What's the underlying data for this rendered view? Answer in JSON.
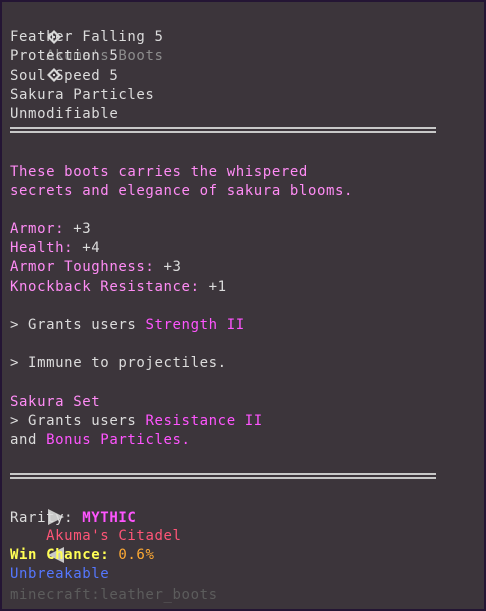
{
  "item": {
    "name": "Akuma's Boots",
    "icon_left": "diamond-icon",
    "icon_right": "diamond-icon",
    "enchantments": [
      "Feather Falling 5",
      "Protection 5",
      "Soul Speed 5",
      "Sakura Particles",
      "Unmodifiable"
    ],
    "lore": [
      "These boots carries the whispered",
      "secrets and elegance of sakura blooms."
    ],
    "stats": [
      {
        "label": "Armor:",
        "value": "+3"
      },
      {
        "label": "Health:",
        "value": "+4"
      },
      {
        "label": "Armor Toughness:",
        "value": "+3"
      },
      {
        "label": "Knockback Resistance:",
        "value": "+1"
      }
    ],
    "ability1": {
      "prefix": "> Grants users ",
      "highlight": "Strength II"
    },
    "ability2": "> Immune to projectiles.",
    "set": {
      "title": "Sakura Set",
      "line1_prefix": "> Grants users ",
      "line1_highlight": "Resistance II",
      "line2_prefix": "and ",
      "line2_highlight": "Bonus Particles."
    },
    "source": "Akuma's Citadel",
    "rarity_label": "Rarity:",
    "rarity_value": "MYTHIC",
    "win_chance_label": "Win Chance:",
    "win_chance_value": "0.6%",
    "unbreakable": "Unbreakable",
    "item_id": "minecraft:leather_boots"
  },
  "colors": {
    "background": "#3c353b",
    "border": "#241534",
    "pink": "#ff8cf5",
    "magenta": "#ff55ff",
    "red": "#ff5577",
    "yellow": "#ffff55",
    "orange": "#ffaa33",
    "blue": "#5577ff"
  }
}
